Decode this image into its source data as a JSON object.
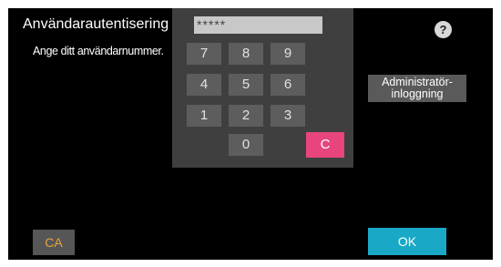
{
  "header": {
    "title": "Användarautentisering",
    "prompt": "Ange ditt användarnummer.",
    "help_icon": "?"
  },
  "pin": {
    "masked_value": "*****"
  },
  "keypad": {
    "keys": [
      "7",
      "8",
      "9",
      "4",
      "5",
      "6",
      "1",
      "2",
      "3",
      "0"
    ],
    "clear_label": "C"
  },
  "buttons": {
    "admin_login_line1": "Administratör-",
    "admin_login_line2": "inloggning",
    "ca_label": "CA",
    "ok_label": "OK"
  },
  "colors": {
    "clear_key": "#e8457e",
    "ok_button": "#19a9c6",
    "ca_text": "#e8a23c"
  }
}
